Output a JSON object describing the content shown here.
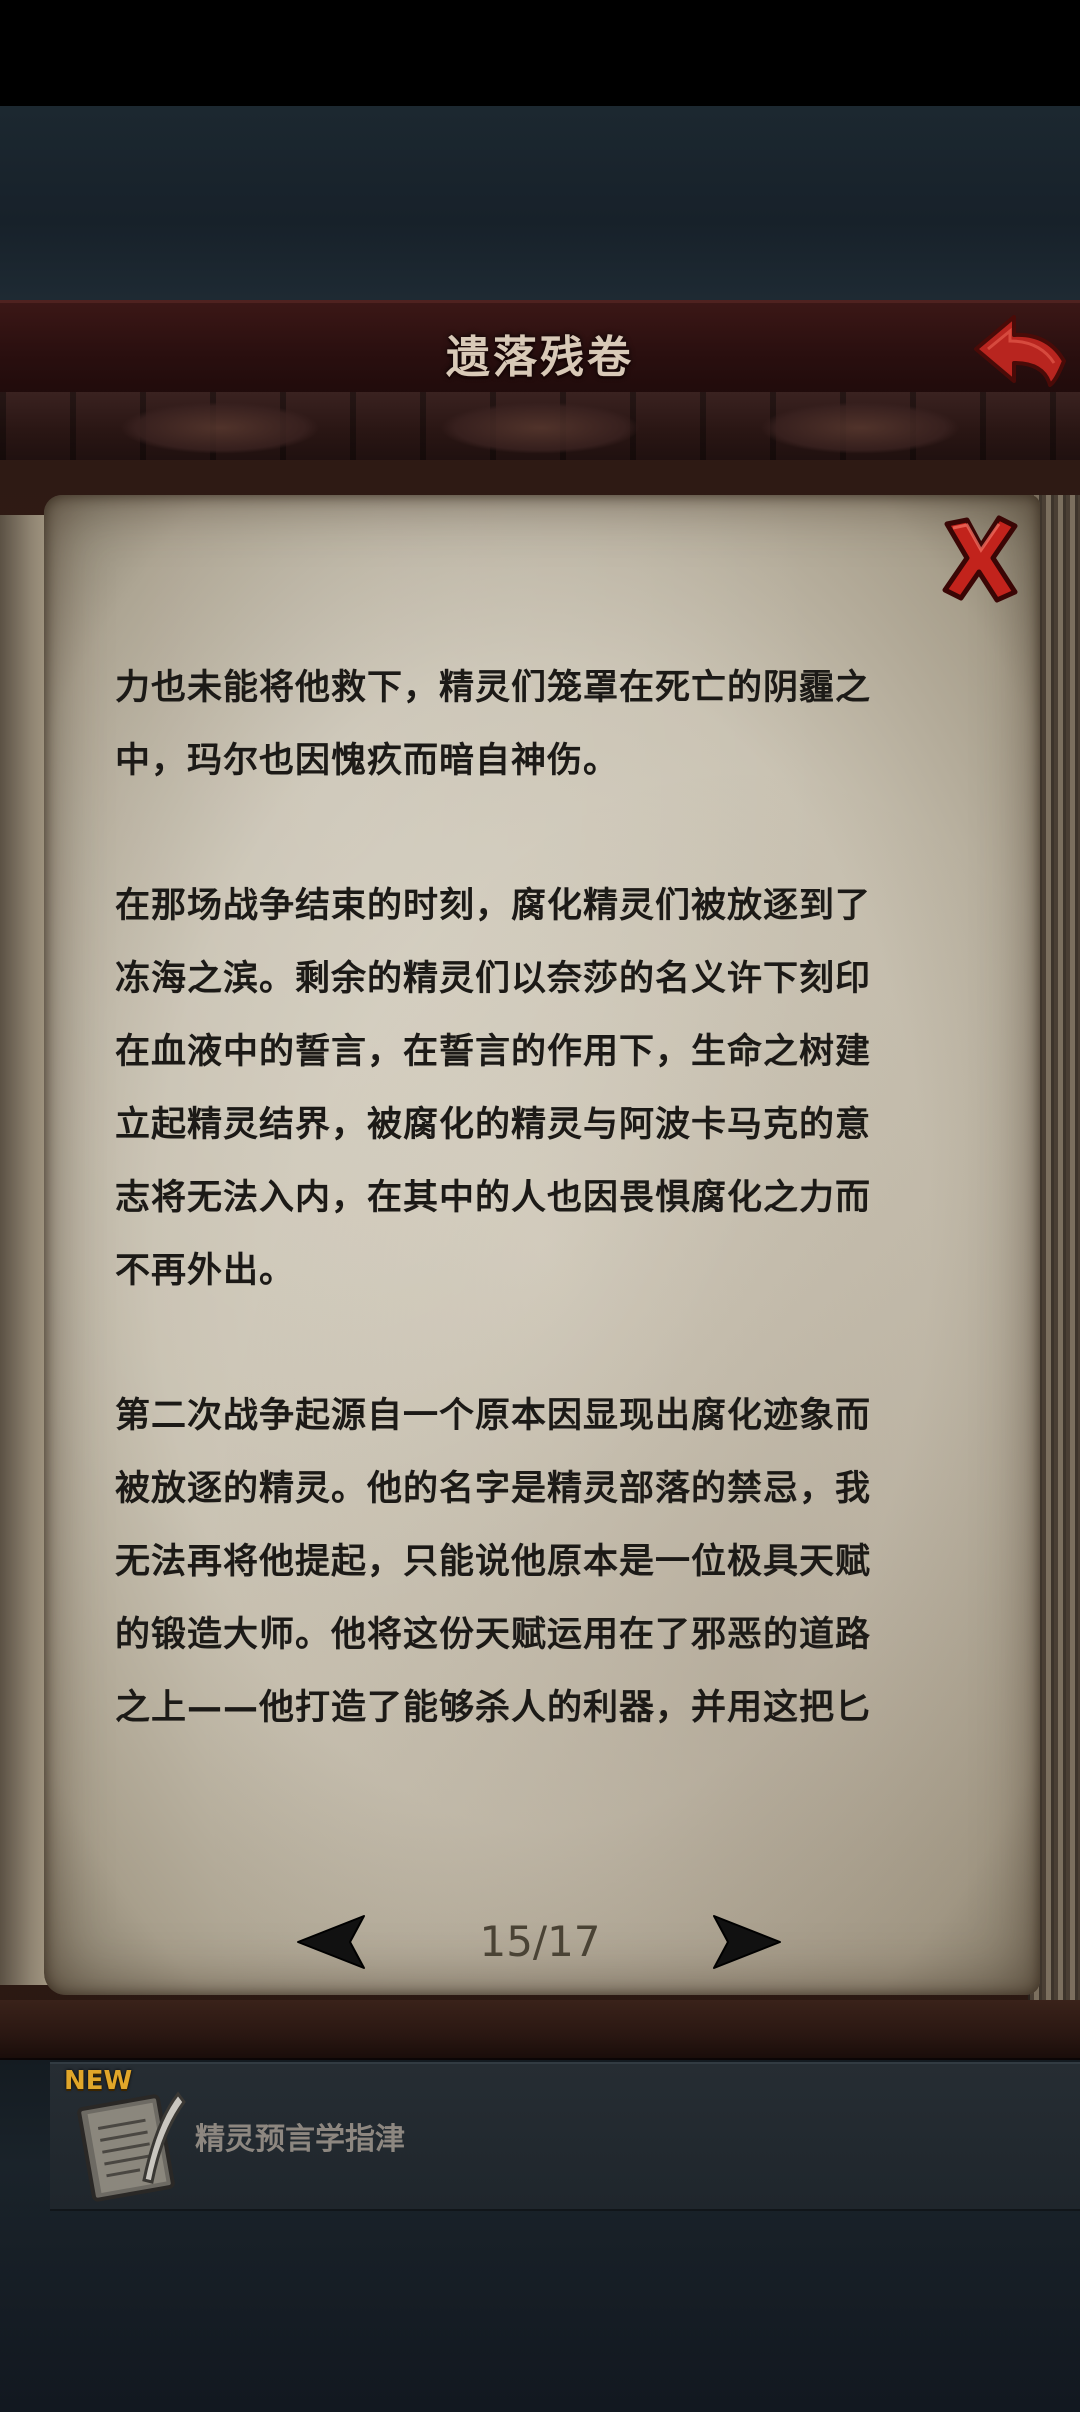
{
  "header": {
    "title": "遗落残卷",
    "back_icon": "back-arrow-icon"
  },
  "book": {
    "close_icon": "close-x-icon",
    "paragraphs": [
      {
        "lines": [
          "力也未能将他救下，精灵们笼罩在死亡的阴霾之",
          "中，玛尔也因愧疚而暗自神伤。"
        ]
      },
      {
        "lines": [
          "在那场战争结束的时刻，腐化精灵们被放逐到了",
          "冻海之滨。剩余的精灵们以奈莎的名义许下刻印",
          "在血液中的誓言，在誓言的作用下，生命之树建",
          "立起精灵结界，被腐化的精灵与阿波卡马克的意",
          "志将无法入内，在其中的人也因畏惧腐化之力而",
          "不再外出。"
        ]
      },
      {
        "lines": [
          "第二次战争起源自一个原本因显现出腐化迹象而",
          "被放逐的精灵。他的名字是精灵部落的禁忌，我",
          "无法再将他提起，只能说他原本是一位极具天赋",
          "的锻造大师。他将这份天赋运用在了邪恶的道路",
          "之上——他打造了能够杀人的利器，并用这把匕"
        ]
      }
    ],
    "pagination": {
      "current": "15/17",
      "prev_icon": "left-arrow-icon",
      "next_icon": "right-arrow-icon"
    }
  },
  "new_item": {
    "badge": "NEW",
    "label": "精灵预言学指津",
    "icon": "scroll-quill-icon"
  },
  "colors": {
    "title_bar": "#2a0f0f",
    "accent_red": "#b8251f",
    "parchment": "#d2cbbb",
    "text": "#1c1a17",
    "new_badge": "#e0a62a"
  }
}
